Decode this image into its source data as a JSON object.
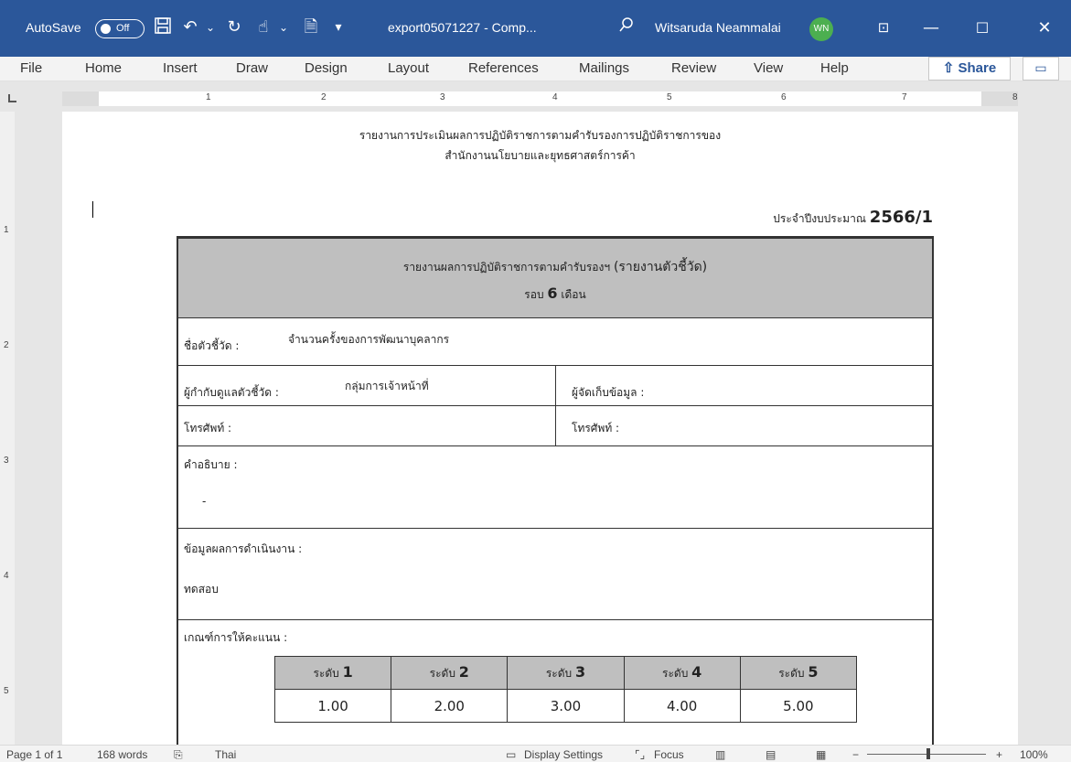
{
  "titlebar": {
    "autosave_label": "AutoSave",
    "autosave_state": "Off",
    "filename": "export05071227 - Comp...",
    "user_name": "Witsaruda Neammalai",
    "user_initials": "WN",
    "accent": "#2b579a"
  },
  "menu": {
    "items": [
      "File",
      "Home",
      "Insert",
      "Draw",
      "Design",
      "Layout",
      "References",
      "Mailings",
      "Review",
      "View",
      "Help"
    ],
    "share_label": "Share"
  },
  "ruler": {
    "h_numbers": [
      "1",
      "2",
      "3",
      "4",
      "5",
      "6",
      "7",
      "8"
    ],
    "v_numbers": [
      "1",
      "2",
      "3",
      "4",
      "5"
    ]
  },
  "document": {
    "heading_line1": "รายงานการประเมินผลการปฏิบัติราชการตามคำรับรองการปฏิบัติราชการของ",
    "heading_line2": "สำนักงานนโยบายและยุทธศาสตร์การค้า",
    "fiscal_label": "ประจำปีงบประมาณ",
    "fiscal_year": "2566/1",
    "form": {
      "header_title": "รายงานผลการปฏิบัติราชการตามคำรับรองฯ",
      "header_paren": "(รายงานตัวชี้วัด)",
      "round_label": "รอบ",
      "round_value": "6",
      "round_unit": "เดือน",
      "indicator_label": "ชื่อตัวชี้วัด :",
      "indicator_value": "จำนวนครั้งของการพัฒนาบุคลากร",
      "supervisor_label": "ผู้กำกับดูแลตัวชี้วัด :",
      "supervisor_value": "กลุ่มการเจ้าหน้าที่",
      "collector_label": "ผู้จัดเก็บข้อมูล :",
      "phone_label_left": "โทรศัพท์ :",
      "phone_label_right": "โทรศัพท์ :",
      "description_label": "คำอธิบาย :",
      "description_value": "-",
      "performance_label": "ข้อมูลผลการดำเนินงาน :",
      "performance_value": "ทดสอบ",
      "criteria_label": "เกณฑ์การให้คะแนน :",
      "level_word": "ระดับ",
      "levels": [
        "1",
        "2",
        "3",
        "4",
        "5"
      ],
      "scores": [
        "1.00",
        "2.00",
        "3.00",
        "4.00",
        "5.00"
      ]
    }
  },
  "statusbar": {
    "page": "Page 1 of 1",
    "words": "168 words",
    "language": "Thai",
    "display_settings": "Display Settings",
    "focus": "Focus",
    "zoom": "100%"
  }
}
